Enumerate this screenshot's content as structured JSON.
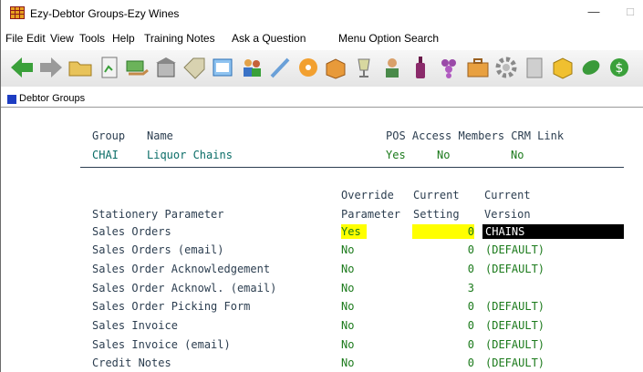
{
  "window": {
    "title": "Ezy-Debtor Groups-Ezy Wines",
    "minimize_label": "—",
    "maximize_label": "□"
  },
  "menu": [
    "File",
    "Edit",
    "View",
    "Tools",
    "Help",
    "Training Notes",
    "Ask a Question",
    "Menu Option Search"
  ],
  "toolbar_icons": [
    "back-arrow-icon",
    "forward-arrow-icon",
    "folder-icon",
    "document-icon",
    "hand-money-icon",
    "building-icon",
    "tag-icon",
    "window-icon",
    "people-icon",
    "pen-icon",
    "disc-icon",
    "box-icon",
    "glass-icon",
    "person-icon",
    "bottle-icon",
    "grapes-icon",
    "briefcase-icon",
    "gear-icon",
    "page-icon",
    "cube-icon",
    "leaf-icon",
    "dollar-icon"
  ],
  "panel": {
    "title": "Debtor Groups"
  },
  "group_header": {
    "group": "Group",
    "name": "Name",
    "other": "POS Access Members CRM Link"
  },
  "group_row": {
    "group": "CHAI",
    "name": "Liquor Chains",
    "pos": "Yes",
    "members": "No",
    "crm": "No"
  },
  "param_header": {
    "override_1": "Override",
    "current_1": "Current",
    "current_2": "Current",
    "stationery": "Stationery Parameter",
    "override_2": "Parameter",
    "setting": "Setting",
    "version": "Version"
  },
  "rows": [
    {
      "label": "Sales Orders",
      "override": "Yes",
      "setting": "0",
      "version": "CHAINS"
    },
    {
      "label": "Sales Orders (email)",
      "override": "No",
      "setting": "0",
      "version": "(DEFAULT)"
    },
    {
      "label": "Sales Order Acknowledgement",
      "override": "No",
      "setting": "0",
      "version": "(DEFAULT)"
    },
    {
      "label": "Sales Order Acknowl. (email)",
      "override": "No",
      "setting": "3",
      "version": ""
    },
    {
      "label": "Sales Order Picking Form",
      "override": "No",
      "setting": "0",
      "version": "(DEFAULT)"
    },
    {
      "label": "Sales Invoice",
      "override": "No",
      "setting": "0",
      "version": "(DEFAULT)"
    },
    {
      "label": "Sales Invoice (email)",
      "override": "No",
      "setting": "0",
      "version": "(DEFAULT)"
    },
    {
      "label": "Credit Notes",
      "override": "No",
      "setting": "0",
      "version": "(DEFAULT)"
    }
  ],
  "colors": {
    "accent_blue": "#1d3dc2",
    "highlight_yellow": "#ffff00",
    "value_green": "#1b7a1b",
    "label_dark": "#2c3e50"
  }
}
